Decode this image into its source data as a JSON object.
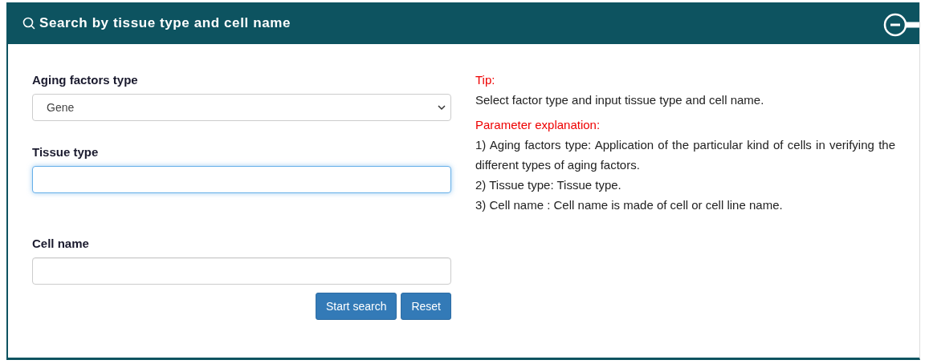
{
  "panel": {
    "title": "Search by tissue type and cell name",
    "collapsed": false
  },
  "fields": [
    {
      "kind": "select",
      "label": "Aging factors type",
      "value": "Gene",
      "focused": false
    },
    {
      "kind": "text",
      "label": "Tissue type",
      "focused": true
    },
    {
      "kind": "text",
      "label": "Cell name",
      "focused": false
    }
  ],
  "buttons": [
    "Start search",
    "Reset"
  ],
  "tip": {
    "heading": "Tip:",
    "text": "Select factor type and input tissue type and cell name."
  },
  "explanation": {
    "heading": "Parameter explanation:",
    "lines": [
      "1) Aging factors type: Application of the particular kind of cells in verifying the different types of aging factors.",
      "2) Tissue type: Tissue type.",
      "3) Cell name : Cell name is made of cell or cell line name."
    ]
  }
}
